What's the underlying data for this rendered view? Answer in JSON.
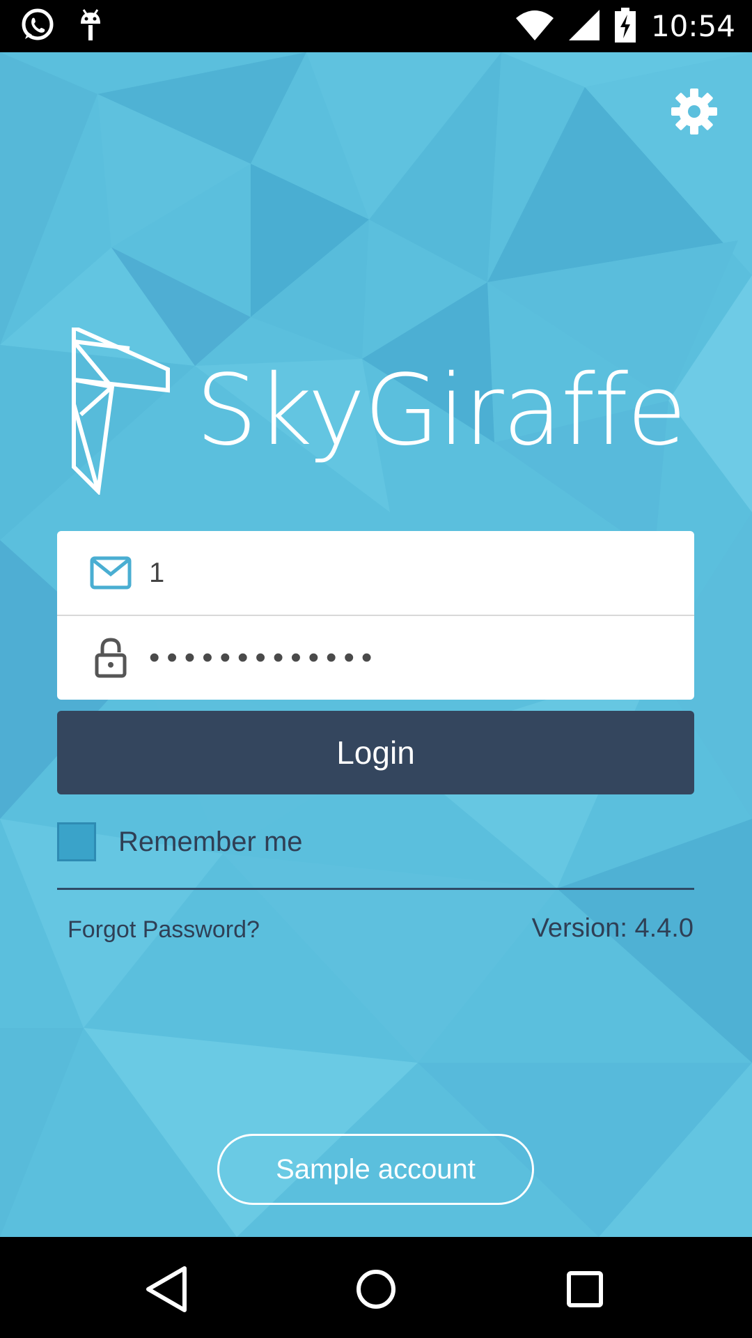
{
  "status_bar": {
    "time": "10:54",
    "icons": [
      "whatsapp-icon",
      "android-debug-icon",
      "wifi-icon",
      "signal-icon",
      "battery-charging-icon"
    ]
  },
  "app": {
    "background_color": "#5bbfdd",
    "logo_text": "SkyGiraffe",
    "settings_icon": "gear-icon"
  },
  "login_form": {
    "email_value": "1",
    "email_icon": "envelope-icon",
    "password_value": "•••••••••••••",
    "password_icon": "lock-icon",
    "login_label": "Login",
    "login_color": "#34465e",
    "remember_label": "Remember me",
    "remember_checked": false,
    "forgot_label": "Forgot Password?",
    "version_text": "Version: 4.4.0"
  },
  "sample_account_label": "Sample account",
  "nav_bar": {
    "icons": [
      "back-icon",
      "home-icon",
      "recents-icon"
    ]
  }
}
